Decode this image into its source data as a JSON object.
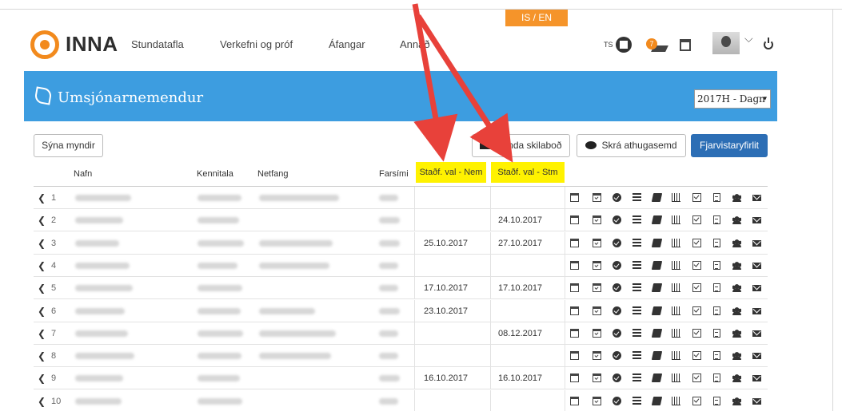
{
  "lang_toggle": "IS / EN",
  "brand": "INNA",
  "nav": [
    "Stundatafla",
    "Verkefni og próf",
    "Áfangar",
    "Annað"
  ],
  "header": {
    "ts_label": "TS",
    "notification_count": "7"
  },
  "banner": {
    "title": "Umsjónarnemendur",
    "semester": "2017H - Dagn",
    "semester_arrow": "▾"
  },
  "toolbar": {
    "show_photos": "Sýna myndir",
    "send_message": "Senda skilaboð",
    "add_note": "Skrá athugasemd",
    "absence_overview": "Fjarvistaryfirlit"
  },
  "table": {
    "headers": {
      "name": "Nafn",
      "kennitala": "Kennitala",
      "email": "Netfang",
      "mobile": "Farsími",
      "confirmed_student": "Staðf. val - Nem",
      "confirmed_admin": "Staðf. val - Stm"
    },
    "rows": [
      {
        "num": "1",
        "nem": "",
        "stm": ""
      },
      {
        "num": "2",
        "nem": "",
        "stm": "24.10.2017"
      },
      {
        "num": "3",
        "nem": "25.10.2017",
        "stm": "27.10.2017"
      },
      {
        "num": "4",
        "nem": "",
        "stm": ""
      },
      {
        "num": "5",
        "nem": "17.10.2017",
        "stm": "17.10.2017"
      },
      {
        "num": "6",
        "nem": "23.10.2017",
        "stm": ""
      },
      {
        "num": "7",
        "nem": "",
        "stm": "08.12.2017"
      },
      {
        "num": "8",
        "nem": "",
        "stm": ""
      },
      {
        "num": "9",
        "nem": "16.10.2017",
        "stm": "16.10.2017"
      },
      {
        "num": "10",
        "nem": "",
        "stm": ""
      }
    ],
    "row_chevron": "❮",
    "row_actions": [
      "calendar-icon",
      "calendar-check-icon",
      "check-circle-icon",
      "list-icon",
      "book-icon",
      "bar-chart-icon",
      "checkbox-icon",
      "document-icon",
      "group-icon",
      "envelope-icon"
    ]
  },
  "colors": {
    "accent_blue": "#3d9de0",
    "brand_orange": "#f28a1d",
    "highlight": "#fff200",
    "arrow_red": "#e8413a",
    "primary_button": "#2c6eb5"
  }
}
